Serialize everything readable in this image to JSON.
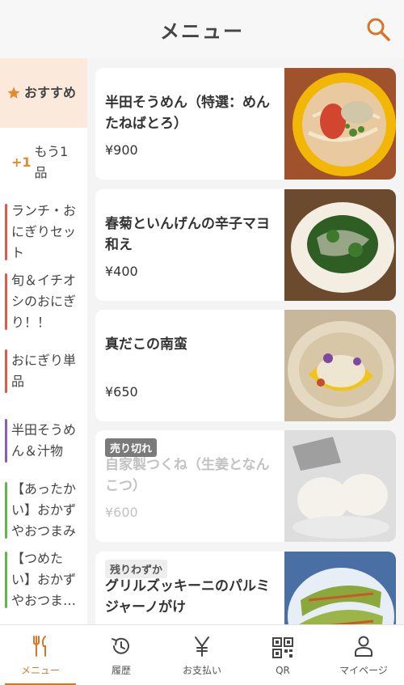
{
  "header": {
    "title": "メニュー"
  },
  "sidebar": {
    "items": [
      {
        "label": "おすすめ"
      },
      {
        "prefix": "+1",
        "label": "もう1品"
      },
      {
        "label": "ランチ・おにぎりセット",
        "bar_color": "#e05a4a"
      },
      {
        "label": "旬＆イチオシのおにぎり！！",
        "bar_color": "#e05a4a"
      },
      {
        "label": "おにぎり単品",
        "bar_color": "#e05a4a"
      },
      {
        "label": "半田そうめん＆汁物",
        "bar_color": "#8e5bb5"
      },
      {
        "label": "【あったかい】おかずやおつまみ",
        "bar_color": "#5fb84a"
      },
      {
        "label": "【つめたい】おかずやおつま…",
        "bar_color": "#5fb84a"
      }
    ]
  },
  "menu": {
    "items": [
      {
        "name": "半田そうめん（特選：めんたねばとろ）",
        "price": "¥900"
      },
      {
        "name": "春菊といんげんの辛子マヨ和え",
        "price": "¥400"
      },
      {
        "name": "真だこの南蛮",
        "price": "¥650"
      },
      {
        "badge": "売り切れ",
        "name": "自家製つくね（生姜となんこつ）",
        "price": "¥600",
        "sold_out": true
      },
      {
        "badge": "残りわずか",
        "name": "グリルズッキーニのパルミジャーノがけ",
        "price": ""
      }
    ]
  },
  "tabbar": {
    "tabs": [
      {
        "label": "メニュー",
        "icon": "fork-knife-icon"
      },
      {
        "label": "履歴",
        "icon": "history-icon"
      },
      {
        "label": "お支払い",
        "icon": "yen-icon"
      },
      {
        "label": "QR",
        "icon": "qr-code-icon"
      },
      {
        "label": "マイページ",
        "icon": "person-icon"
      }
    ]
  },
  "colors": {
    "accent": "#d9752a",
    "active_bg": "#fbe9dc"
  }
}
